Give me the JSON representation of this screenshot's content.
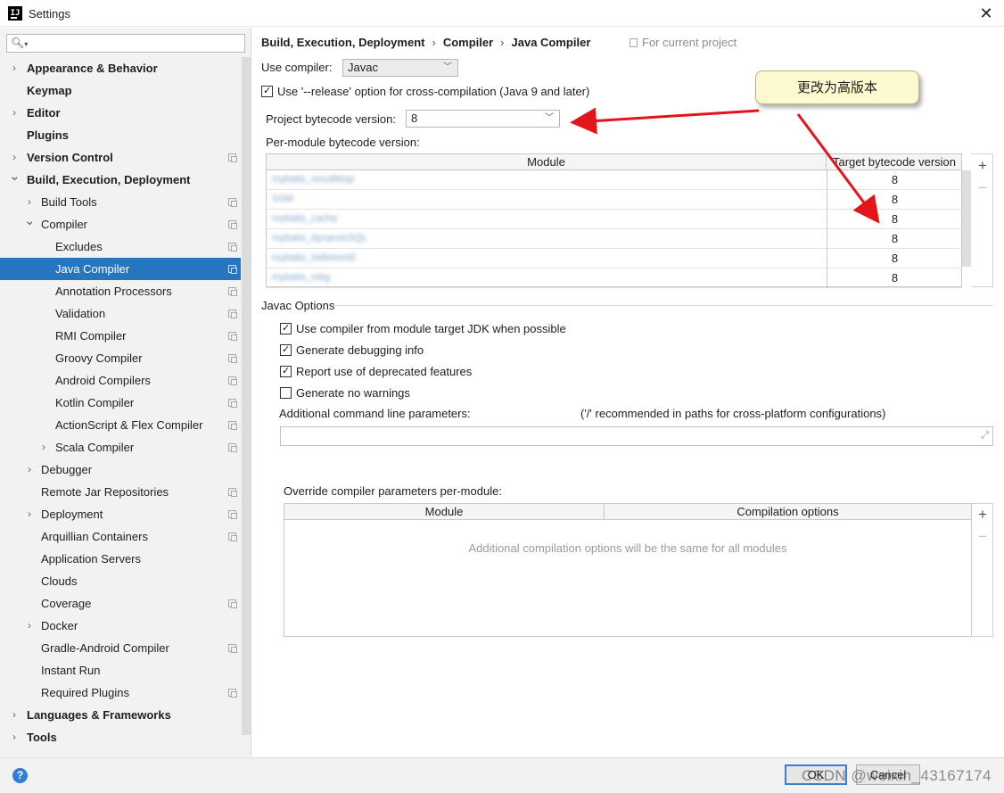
{
  "window": {
    "title": "Settings",
    "app_icon_text": "IJ"
  },
  "sidebar": {
    "items": [
      {
        "label": "Appearance & Behavior",
        "level": 0,
        "chevron": "right",
        "bold": true,
        "copy": false
      },
      {
        "label": "Keymap",
        "level": 0,
        "chevron": "none",
        "bold": true,
        "copy": false
      },
      {
        "label": "Editor",
        "level": 0,
        "chevron": "right",
        "bold": true,
        "copy": false
      },
      {
        "label": "Plugins",
        "level": 0,
        "chevron": "none",
        "bold": true,
        "copy": false
      },
      {
        "label": "Version Control",
        "level": 0,
        "chevron": "right",
        "bold": true,
        "copy": true
      },
      {
        "label": "Build, Execution, Deployment",
        "level": 0,
        "chevron": "down",
        "bold": true,
        "copy": false
      },
      {
        "label": "Build Tools",
        "level": 1,
        "chevron": "right",
        "bold": false,
        "copy": true
      },
      {
        "label": "Compiler",
        "level": 1,
        "chevron": "down",
        "bold": false,
        "copy": true
      },
      {
        "label": "Excludes",
        "level": 2,
        "chevron": "none",
        "bold": false,
        "copy": true
      },
      {
        "label": "Java Compiler",
        "level": 2,
        "chevron": "none",
        "bold": false,
        "copy": true,
        "selected": true
      },
      {
        "label": "Annotation Processors",
        "level": 2,
        "chevron": "none",
        "bold": false,
        "copy": true
      },
      {
        "label": "Validation",
        "level": 2,
        "chevron": "none",
        "bold": false,
        "copy": true
      },
      {
        "label": "RMI Compiler",
        "level": 2,
        "chevron": "none",
        "bold": false,
        "copy": true
      },
      {
        "label": "Groovy Compiler",
        "level": 2,
        "chevron": "none",
        "bold": false,
        "copy": true
      },
      {
        "label": "Android Compilers",
        "level": 2,
        "chevron": "none",
        "bold": false,
        "copy": true
      },
      {
        "label": "Kotlin Compiler",
        "level": 2,
        "chevron": "none",
        "bold": false,
        "copy": true
      },
      {
        "label": "ActionScript & Flex Compiler",
        "level": 2,
        "chevron": "none",
        "bold": false,
        "copy": true
      },
      {
        "label": "Scala Compiler",
        "level": 2,
        "chevron": "right",
        "bold": false,
        "copy": true
      },
      {
        "label": "Debugger",
        "level": 1,
        "chevron": "right",
        "bold": false,
        "copy": false
      },
      {
        "label": "Remote Jar Repositories",
        "level": 1,
        "chevron": "none",
        "bold": false,
        "copy": true
      },
      {
        "label": "Deployment",
        "level": 1,
        "chevron": "right",
        "bold": false,
        "copy": true
      },
      {
        "label": "Arquillian Containers",
        "level": 1,
        "chevron": "none",
        "bold": false,
        "copy": true
      },
      {
        "label": "Application Servers",
        "level": 1,
        "chevron": "none",
        "bold": false,
        "copy": false
      },
      {
        "label": "Clouds",
        "level": 1,
        "chevron": "none",
        "bold": false,
        "copy": false
      },
      {
        "label": "Coverage",
        "level": 1,
        "chevron": "none",
        "bold": false,
        "copy": true
      },
      {
        "label": "Docker",
        "level": 1,
        "chevron": "right",
        "bold": false,
        "copy": false
      },
      {
        "label": "Gradle-Android Compiler",
        "level": 1,
        "chevron": "none",
        "bold": false,
        "copy": true
      },
      {
        "label": "Instant Run",
        "level": 1,
        "chevron": "none",
        "bold": false,
        "copy": false
      },
      {
        "label": "Required Plugins",
        "level": 1,
        "chevron": "none",
        "bold": false,
        "copy": true
      },
      {
        "label": "Languages & Frameworks",
        "level": 0,
        "chevron": "right",
        "bold": true,
        "copy": false
      },
      {
        "label": "Tools",
        "level": 0,
        "chevron": "right",
        "bold": true,
        "copy": false
      }
    ]
  },
  "breadcrumb": {
    "parts": [
      "Build, Execution, Deployment",
      "Compiler",
      "Java Compiler"
    ],
    "scope": "For current project"
  },
  "compiler": {
    "use_compiler_label": "Use compiler:",
    "use_compiler_value": "Javac",
    "release_option_label": "Use '--release' option for cross-compilation (Java 9 and later)",
    "release_option_checked": true,
    "project_bytecode_label": "Project bytecode version:",
    "project_bytecode_value": "8",
    "per_module_label": "Per-module bytecode version:"
  },
  "module_table": {
    "headers": [
      "Module",
      "Target bytecode version"
    ],
    "rows": [
      {
        "module": "mybatis_resultMap",
        "version": "8"
      },
      {
        "module": "SSM",
        "version": "8"
      },
      {
        "module": "mybatis_cache",
        "version": "8"
      },
      {
        "module": "mybatis_dynamicSQL",
        "version": "8"
      },
      {
        "module": "mybatis_helloworld",
        "version": "8"
      },
      {
        "module": "mybatis_mbg",
        "version": "8"
      }
    ]
  },
  "javac_options": {
    "section_title": "Javac Options",
    "checkboxes": [
      {
        "label": "Use compiler from module target JDK when possible",
        "checked": true
      },
      {
        "label": "Generate debugging info",
        "checked": true
      },
      {
        "label": "Report use of deprecated features",
        "checked": true
      },
      {
        "label": "Generate no warnings",
        "checked": false
      }
    ],
    "additional_params_label": "Additional command line parameters:",
    "additional_params_hint": "('/' recommended in paths for cross-platform configurations)",
    "additional_params_value": ""
  },
  "override": {
    "label": "Override compiler parameters per-module:",
    "headers": [
      "Module",
      "Compilation options"
    ],
    "empty_text": "Additional compilation options will be the same for all modules"
  },
  "annotation": {
    "callout_text": "更改为高版本",
    "arrow_color": "#e3141a"
  },
  "footer": {
    "ok_label": "OK",
    "cancel_label": "Cancel",
    "watermark": "CSDN @weixin_43167174"
  },
  "colors": {
    "selection": "#2675bf",
    "help": "#2f7ed8",
    "callout_bg": "#fdfad0"
  }
}
